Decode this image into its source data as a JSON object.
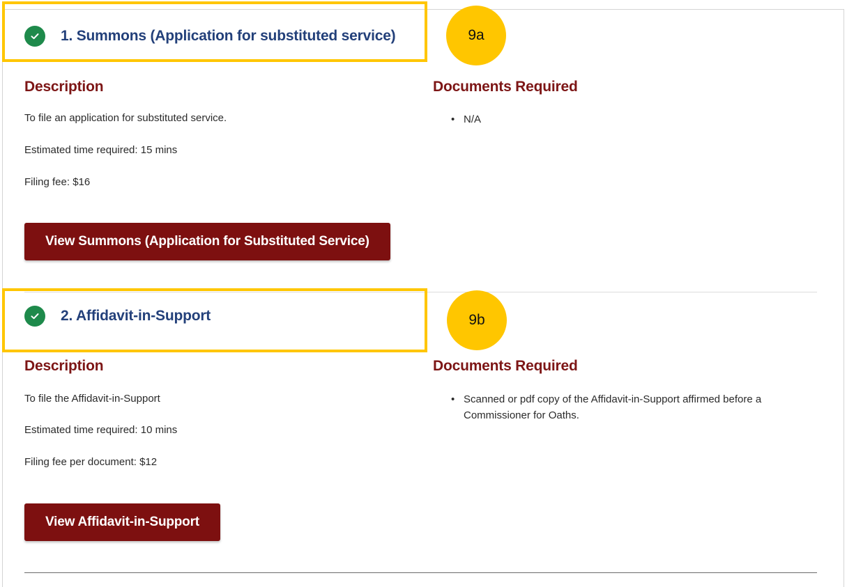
{
  "steps": [
    {
      "title": "1. Summons (Application for substituted service)",
      "callout": "9a",
      "description_heading": "Description",
      "description": "To file an application for substituted service.",
      "time": "Estimated time required: 15 mins",
      "fee": "Filing fee: $16",
      "button": "View Summons (Application for Substituted Service)",
      "documents_heading": "Documents Required",
      "documents": [
        "N/A"
      ]
    },
    {
      "title": "2. Affidavit-in-Support",
      "callout": "9b",
      "description_heading": "Description",
      "description": "To file the Affidavit-in-Support",
      "time": "Estimated time required: 10 mins",
      "fee": "Filing fee per document: $12",
      "button": "View Affidavit-in-Support",
      "documents_heading": "Documents Required",
      "documents": [
        "Scanned or pdf copy of the Affidavit-in-Support affirmed before a Commissioner for Oaths."
      ]
    }
  ],
  "colors": {
    "title": "#23407a",
    "heading": "#7d1616",
    "button": "#7d1010",
    "check": "#1e8a4b",
    "highlight": "#ffc600"
  },
  "icons": {
    "completed": "check-circle-icon"
  }
}
